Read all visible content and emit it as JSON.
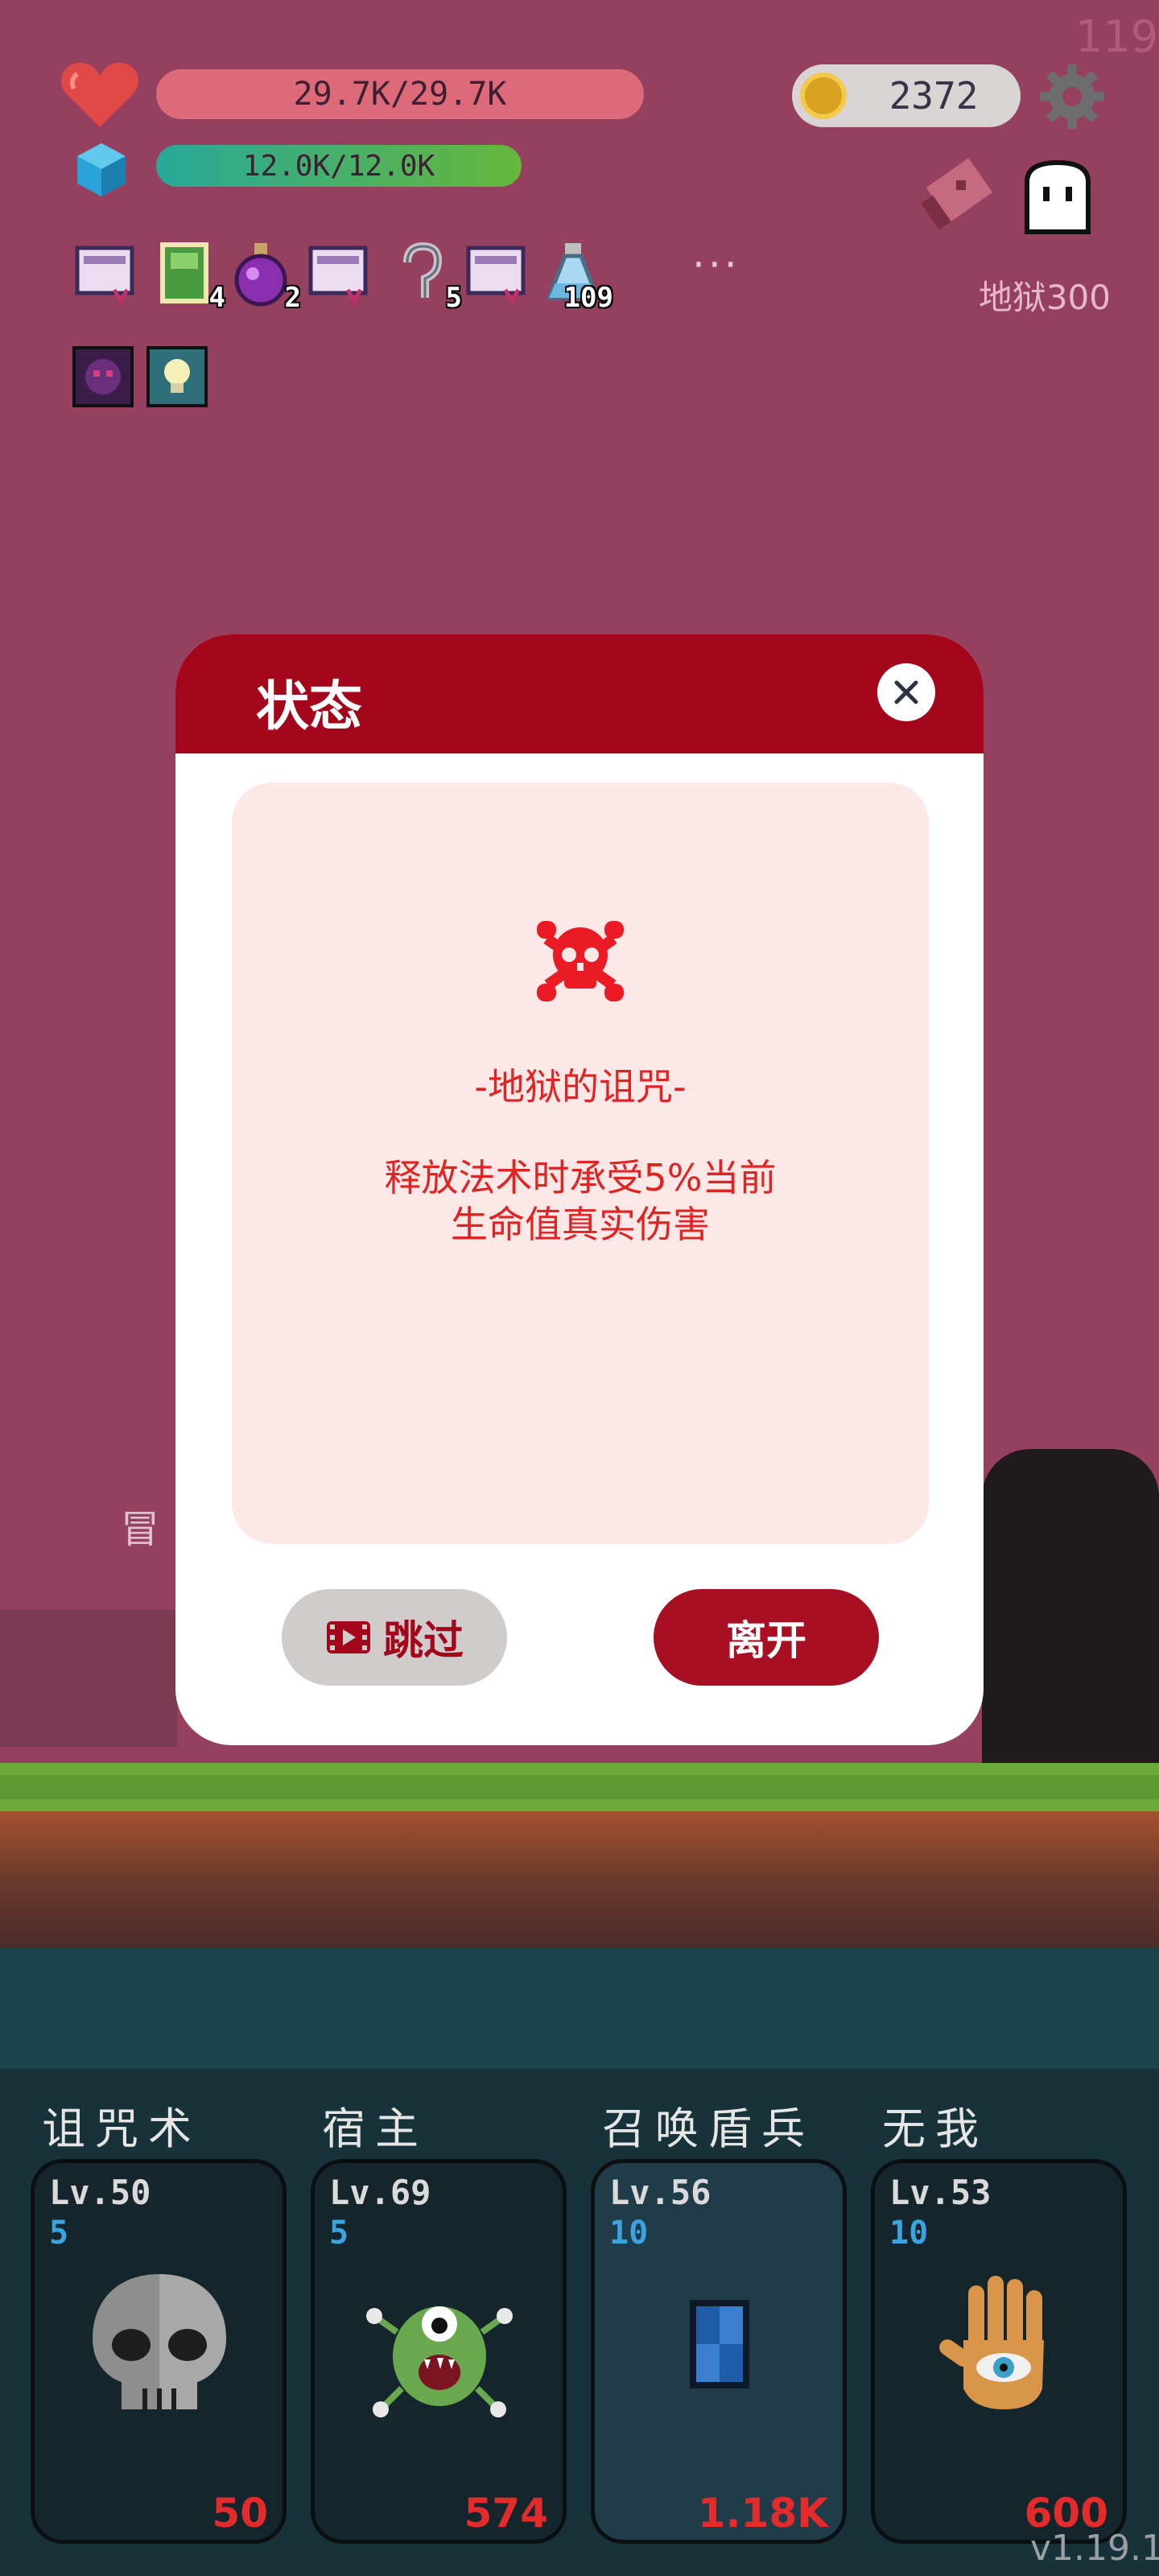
{
  "fps": "119",
  "hud": {
    "hp_text": "29.7K/29.7K",
    "hp_fraction": 1.0,
    "mp_text": "12.0K/12.0K",
    "mp_fraction": 1.0,
    "coins": "2372",
    "level_label": "地狱300"
  },
  "buffs": [
    {
      "icon": "scroll-icon",
      "count": ""
    },
    {
      "icon": "green-card-icon",
      "count": "4"
    },
    {
      "icon": "purple-potion-icon",
      "count": "2"
    },
    {
      "icon": "scroll-icon",
      "count": ""
    },
    {
      "icon": "hook-icon",
      "count": "5"
    },
    {
      "icon": "scroll-icon",
      "count": ""
    },
    {
      "icon": "blue-flask-icon",
      "count": "109"
    }
  ],
  "more_label": "···",
  "modal": {
    "title": "状态",
    "curse_name": "-地狱的诅咒-",
    "curse_desc": "释放法术时承受5%当前生命值真实伤害",
    "skip_label": "跳过",
    "leave_label": "离开"
  },
  "skills": [
    {
      "name": "诅咒术",
      "level": "Lv.50",
      "cost": "5",
      "value": "50",
      "icon": "skull-icon"
    },
    {
      "name": "宿主",
      "level": "Lv.69",
      "cost": "5",
      "value": "574",
      "icon": "green-monster-icon"
    },
    {
      "name": "召唤盾兵",
      "level": "Lv.56",
      "cost": "10",
      "value": "1.18K",
      "icon": "blue-shield-icon"
    },
    {
      "name": "无我",
      "level": "Lv.53",
      "cost": "10",
      "value": "600",
      "icon": "eye-hand-icon"
    }
  ],
  "version": "v1.19.1",
  "colors": {
    "modal_header": "#a4071b",
    "curse_text": "#e02424",
    "background": "#96405f"
  }
}
